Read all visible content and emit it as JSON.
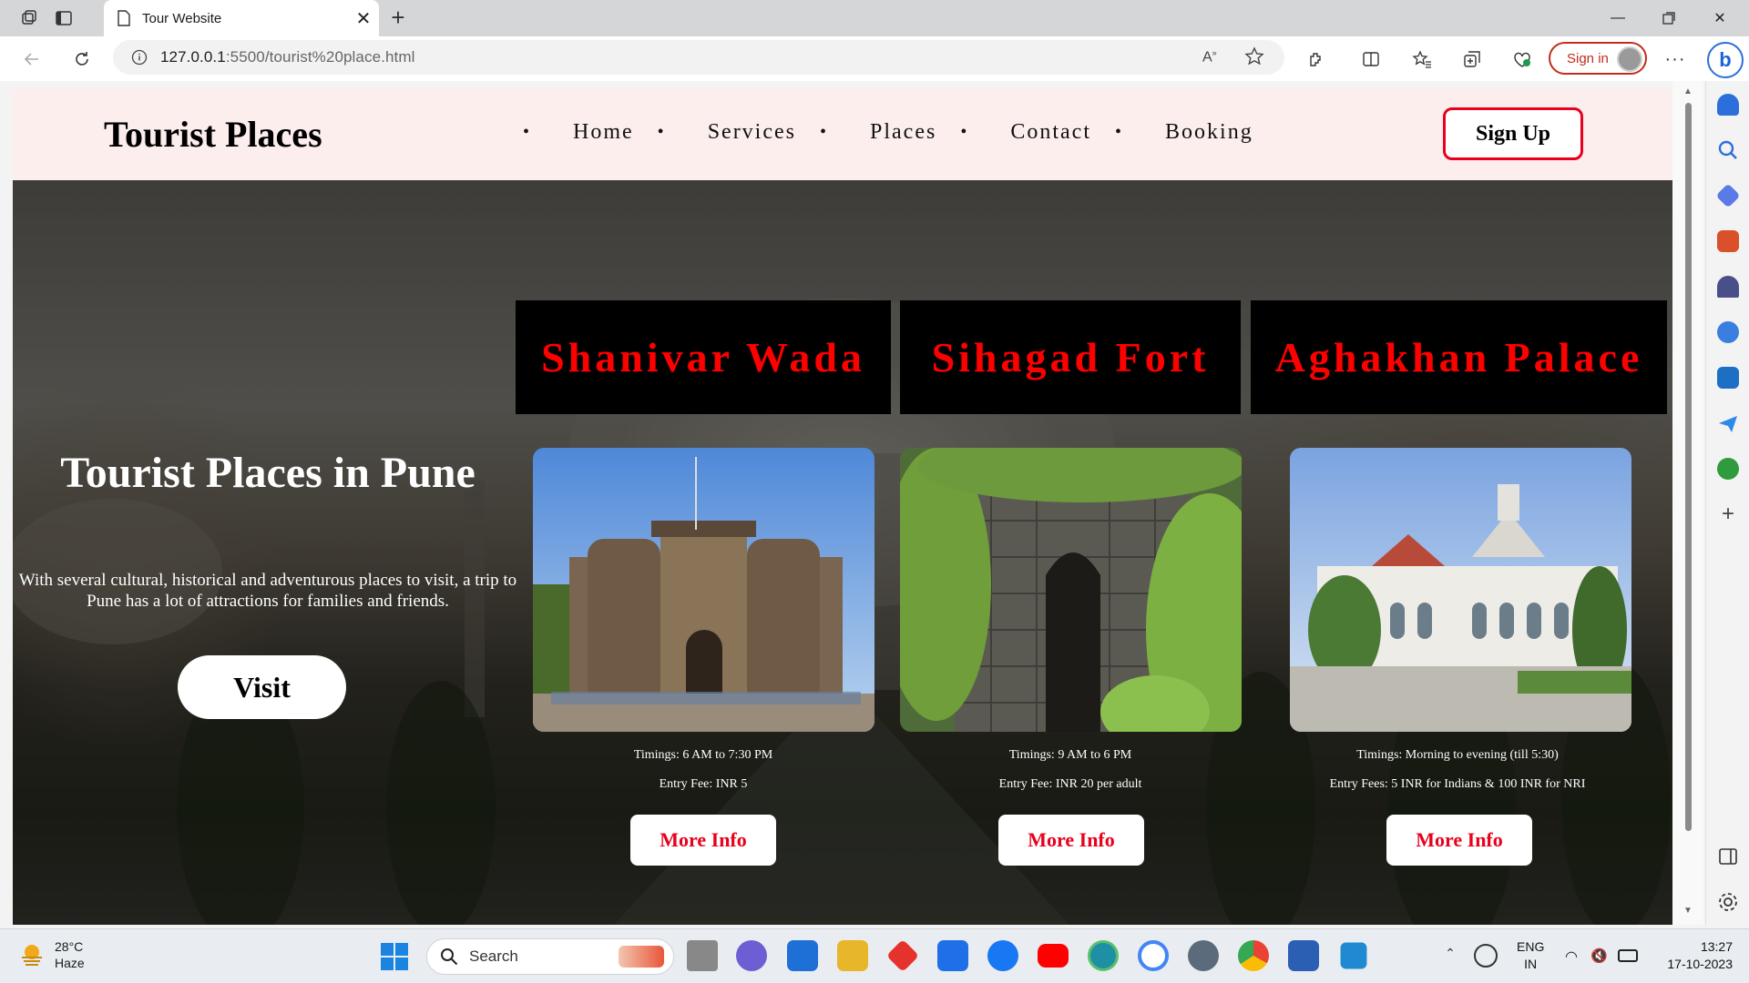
{
  "browser": {
    "tab_title": "Tour Website",
    "url_host": "127.0.0.1",
    "url_path": ":5500/tourist%20place.html",
    "sign_in_label": "Sign in",
    "accent_color": "#c42b1c"
  },
  "site": {
    "brand": "Tourist Places",
    "nav": [
      "Home",
      "Services",
      "Places",
      "Contact",
      "Booking"
    ],
    "signup_label": "Sign Up",
    "hero": {
      "title": "Tourist Places in Pune",
      "description": "With several cultural, historical and adventurous places to visit, a trip to Pune has a lot of attractions for families and friends.",
      "visit_label": "Visit"
    },
    "places": [
      {
        "name": "Shanivar Wada",
        "timings": "Timings: 6 AM to 7:30 PM",
        "fee": "Entry Fee: INR 5",
        "button": "More Info"
      },
      {
        "name": "Sihagad Fort",
        "timings": "Timings: 9 AM to 6 PM",
        "fee": "Entry Fee: INR 20 per adult",
        "button": "More Info"
      },
      {
        "name": "Aghakhan Palace",
        "timings": "Timings: Morning to evening (till 5:30)",
        "fee": "Entry Fees: 5 INR for Indians & 100 INR for NRI",
        "button": "More Info"
      }
    ],
    "colors": {
      "navbar_bg": "#fdeeee",
      "heading_red": "#ff0000",
      "button_red": "#e8001c"
    }
  },
  "taskbar": {
    "weather_temp": "28°C",
    "weather_desc": "Haze",
    "search_placeholder": "Search",
    "lang_top": "ENG",
    "lang_bottom": "IN",
    "time": "13:27",
    "date": "17-10-2023"
  }
}
